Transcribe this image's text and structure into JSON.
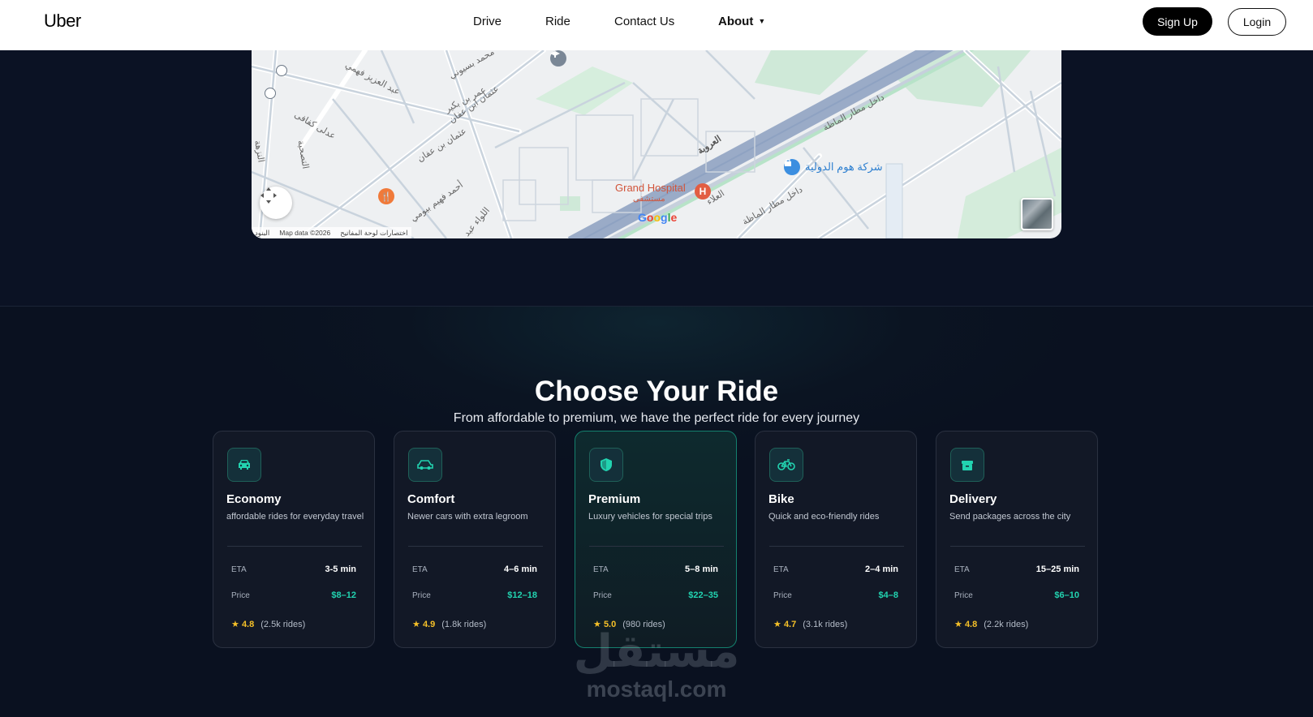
{
  "header": {
    "logo": "Uber",
    "nav": [
      {
        "label": "Drive"
      },
      {
        "label": "Ride"
      },
      {
        "label": "Contact Us"
      },
      {
        "label": "About"
      }
    ],
    "signup_label": "Sign Up",
    "login_label": "Login"
  },
  "map": {
    "labels": {
      "grand_hospital": "Grand Hospital",
      "grand_hospital_ar": "مستشفى",
      "home_company": "شركة هوم الدولية",
      "oruba": "العروبة",
      "alaa": "العلاء",
      "othman1": "عثمان ابن عفان",
      "othman2": "عثمان بن عفان",
      "abdelaziz": "عبد العزيز فهمي",
      "omar": "عمر بن بكير",
      "adly": "عدلى كفافى",
      "nozha": "النزهة",
      "ahmed": "أحمد فهيم بيومي",
      "airport1": "داخل مطار الماظة",
      "airport2": "داخل مطار الماظة",
      "bassiouny": "محمد بسيوني",
      "tasheh": "التصحية",
      "lewaa": "اللواء عبد"
    },
    "attribution": "Map data ©2026",
    "shortcuts": "اختصارات لوحة المفاتيح",
    "terms": "البنود",
    "google": "Google"
  },
  "section": {
    "title": "Choose Your Ride",
    "subtitle": "From affordable to premium, we have the perfect ride for every journey"
  },
  "rides": [
    {
      "title": "Economy",
      "desc": "affordable rides for everyday travel",
      "eta_label": "ETA",
      "eta": "3-5 min",
      "price_label": "Price",
      "price": "$8–12",
      "star": "★",
      "rating": "4.8",
      "rides": "(2.5k rides)",
      "icon": "car-front-icon"
    },
    {
      "title": "Comfort",
      "desc": "Newer cars with extra legroom",
      "eta_label": "ETA",
      "eta": "4–6 min",
      "price_label": "Price",
      "price": "$12–18",
      "star": "★",
      "rating": "4.9",
      "rides": "(1.8k rides)",
      "icon": "car-icon"
    },
    {
      "title": "Premium",
      "desc": "Luxury vehicles for special trips",
      "eta_label": "ETA",
      "eta": "5–8 min",
      "price_label": "Price",
      "price": "$22–35",
      "star": "★",
      "rating": "5.0",
      "rides": "(980 rides)",
      "icon": "shield-icon"
    },
    {
      "title": "Bike",
      "desc": "Quick and eco-friendly rides",
      "eta_label": "ETA",
      "eta": "2–4 min",
      "price_label": "Price",
      "price": "$4–8",
      "star": "★",
      "rating": "4.7",
      "rides": "(3.1k rides)",
      "icon": "bicycle-icon"
    },
    {
      "title": "Delivery",
      "desc": "Send packages across the city",
      "eta_label": "ETA",
      "eta": "15–25 min",
      "price_label": "Price",
      "price": "$6–10",
      "star": "★",
      "rating": "4.8",
      "rides": "(2.2k rides)",
      "icon": "package-icon"
    }
  ],
  "watermark": {
    "arabic": "مستقل",
    "latin": "mostaql.com"
  },
  "colors": {
    "accent": "#22d3b0",
    "star": "#f5c028",
    "background": "#0b1220"
  }
}
